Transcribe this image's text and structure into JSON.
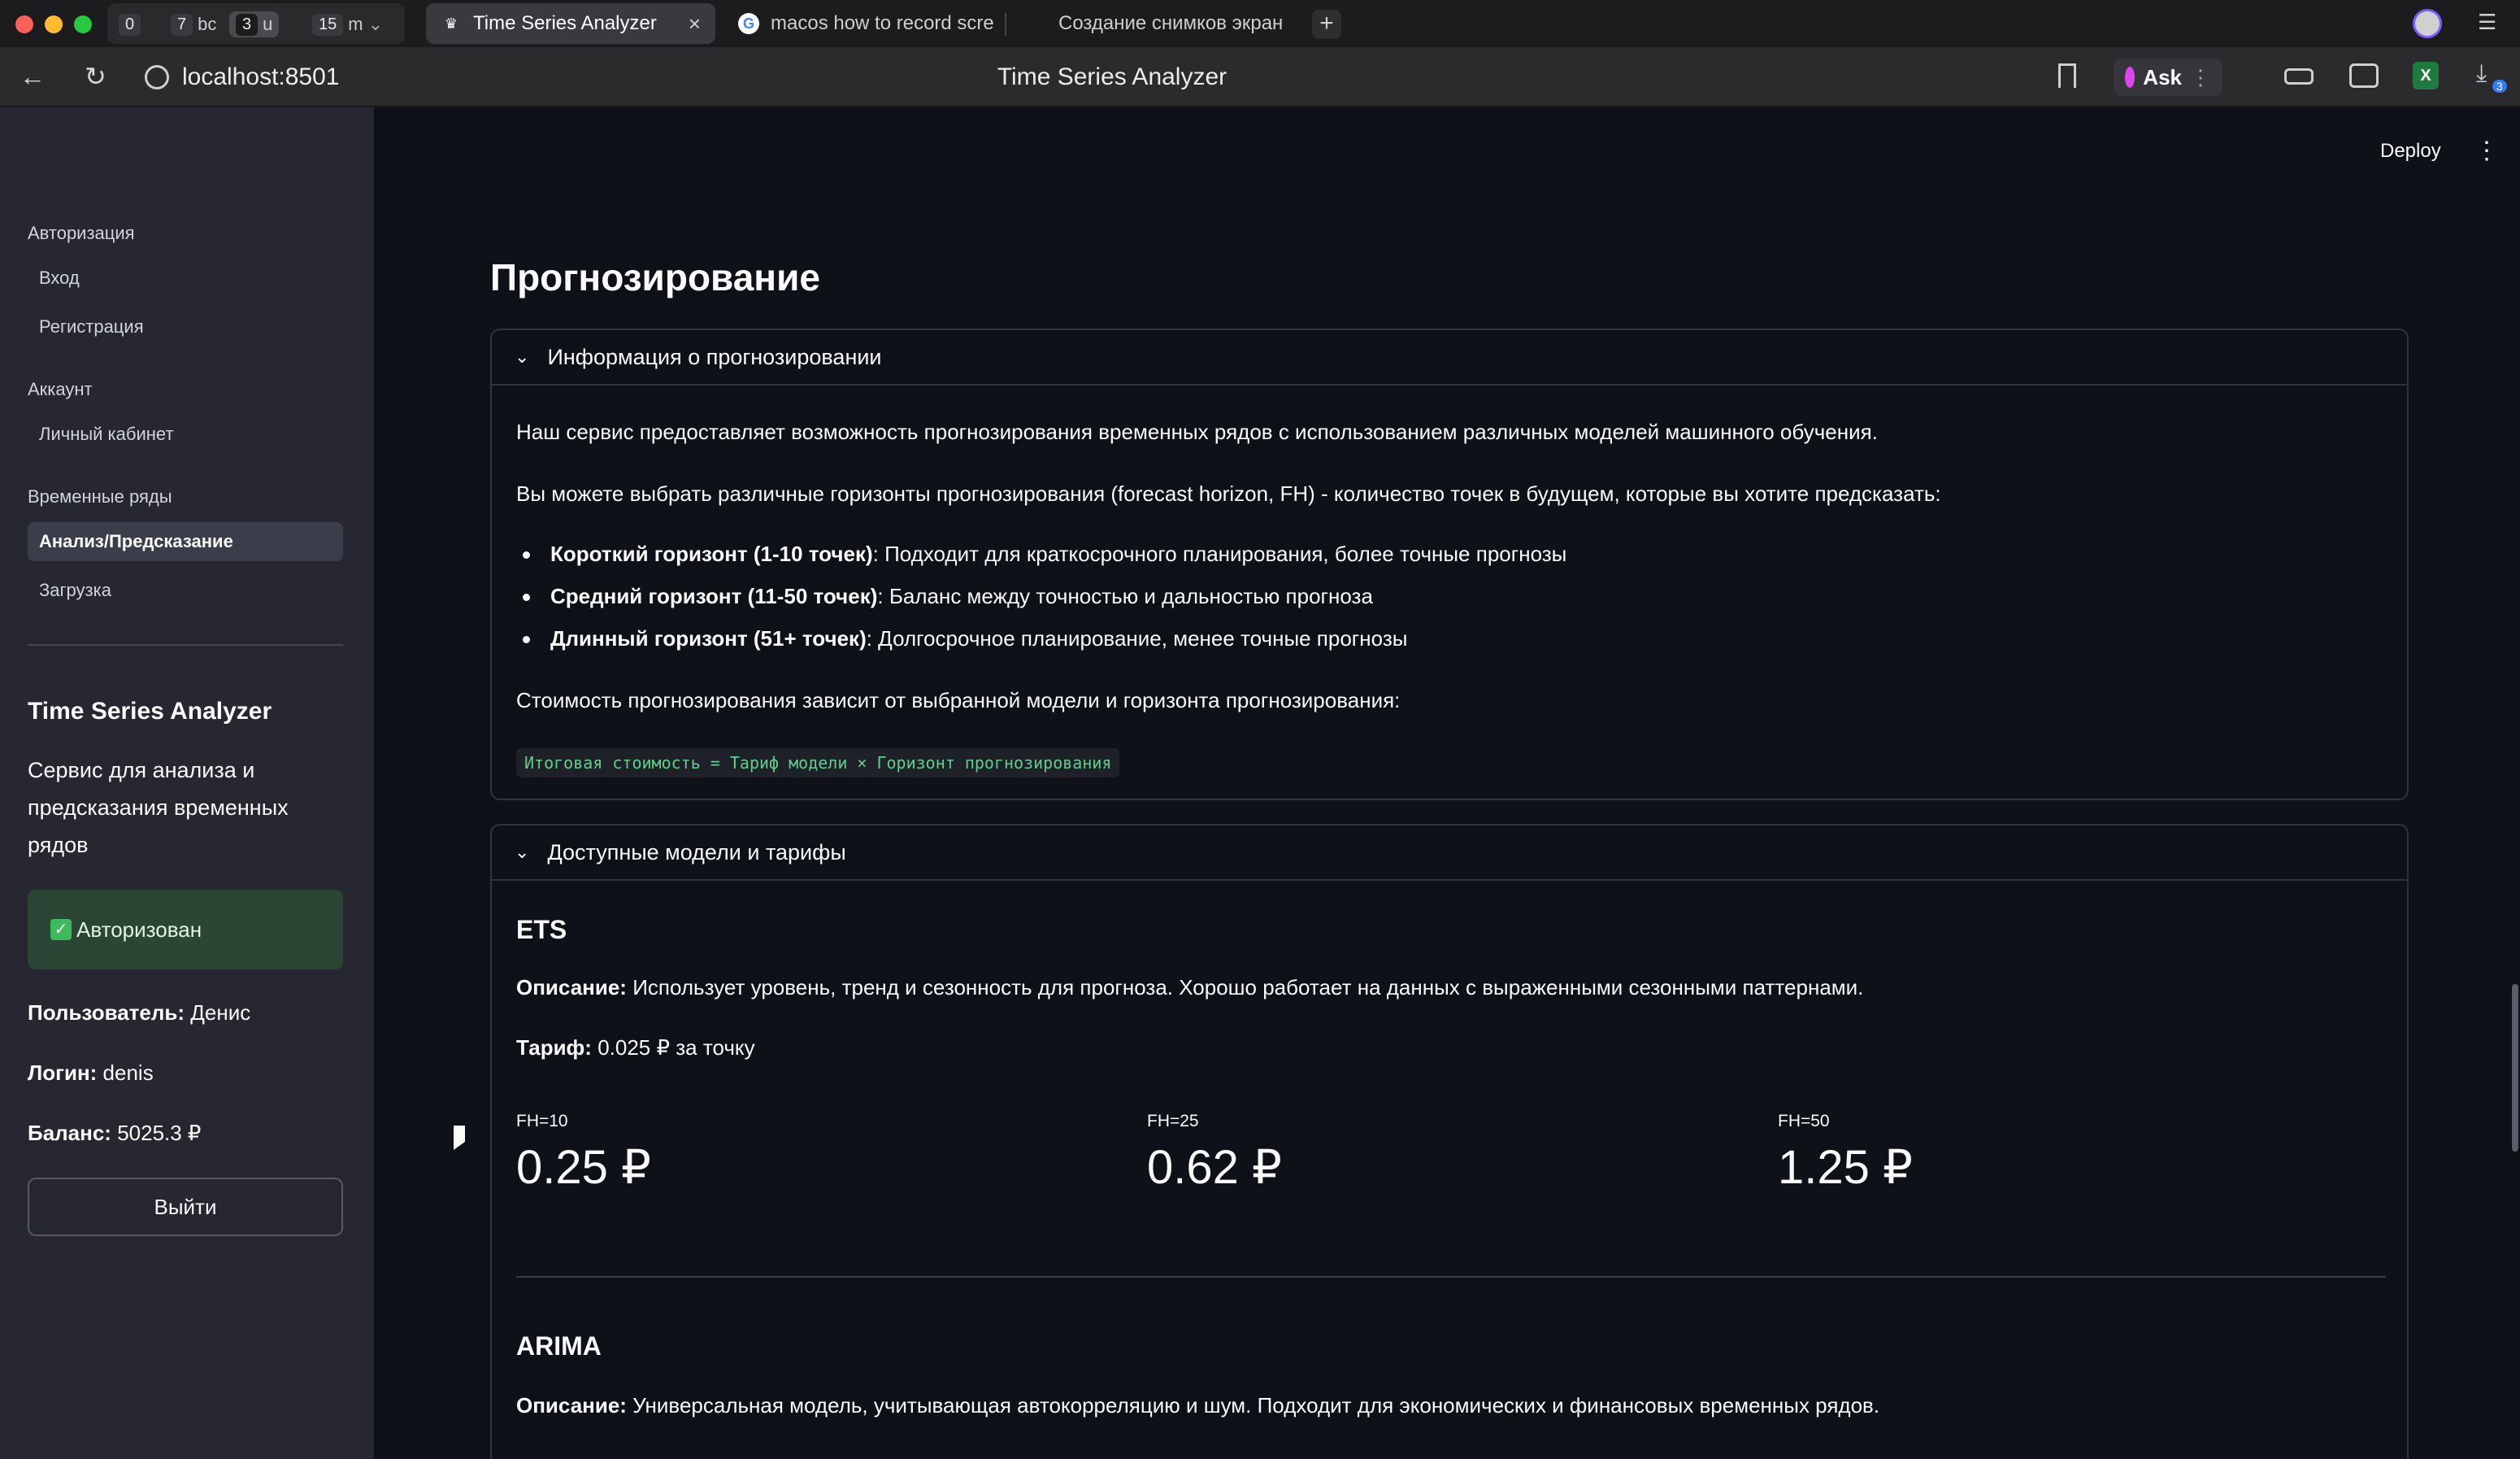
{
  "browser": {
    "tab_groups": [
      {
        "num": "0",
        "sub": ""
      },
      {
        "num": "7",
        "sub": "bc"
      },
      {
        "num": "3",
        "sub": "u"
      },
      {
        "num": "15",
        "sub": "m"
      }
    ],
    "tabs": [
      {
        "title": "Time Series Analyzer"
      },
      {
        "title": "macos how to record scre"
      },
      {
        "title": "Создание снимков экран"
      }
    ],
    "url": "localhost:8501",
    "page_title": "Time Series Analyzer",
    "ask_label": "Ask",
    "downloads_count": "3"
  },
  "sidebar": {
    "sections": {
      "auth": "Авторизация",
      "account": "Аккаунт",
      "timeseries": "Временные ряды"
    },
    "items": {
      "login": "Вход",
      "register": "Регистрация",
      "cabinet": "Личный кабинет",
      "analysis": "Анализ/Предсказание",
      "upload": "Загрузка"
    },
    "app_title": "Time Series Analyzer",
    "app_description": "Сервис для анализа и предсказания временных рядов",
    "auth_status": "Авторизован",
    "user_label": "Пользователь:",
    "user_value": "Денис",
    "login_label": "Логин:",
    "login_value": "denis",
    "balance_label": "Баланс:",
    "balance_value": "5025.3 ₽",
    "logout_label": "Выйти"
  },
  "header": {
    "deploy_label": "Deploy"
  },
  "main": {
    "title": "Прогнозирование",
    "info_expander": {
      "title": "Информация о прогнозировании",
      "p1": "Наш сервис предоставляет возможность прогнозирования временных рядов с использованием различных моделей машинного обучения.",
      "p2": "Вы можете выбрать различные горизонты прогнозирования (forecast horizon, FH) - количество точек в будущем, которые вы хотите предсказать:",
      "bullets": [
        {
          "bold": "Короткий горизонт (1-10 точек)",
          "text": ": Подходит для краткосрочного планирования, более точные прогнозы"
        },
        {
          "bold": "Средний горизонт (11-50 точек)",
          "text": ": Баланс между точностью и дальностью прогноза"
        },
        {
          "bold": "Длинный горизонт (51+ точек)",
          "text": ": Долгосрочное планирование, менее точные прогнозы"
        }
      ],
      "p3": "Стоимость прогнозирования зависит от выбранной модели и горизонта прогнозирования:",
      "formula": "Итоговая стоимость = Тариф модели × Горизонт прогнозирования"
    },
    "models_expander": {
      "title": "Доступные модели и тарифы",
      "description_label": "Описание:",
      "tariff_label": "Тариф:",
      "models": [
        {
          "name": "ETS",
          "description": "Использует уровень, тренд и сезонность для прогноза. Хорошо работает на данных с выраженными сезонными паттернами.",
          "tariff": "0.025 ₽ за точку",
          "metrics": [
            {
              "label": "FH=10",
              "value": "0.25 ₽"
            },
            {
              "label": "FH=25",
              "value": "0.62 ₽"
            },
            {
              "label": "FH=50",
              "value": "1.25 ₽"
            }
          ]
        },
        {
          "name": "ARIMA",
          "description": "Универсальная модель, учитывающая автокорреляцию и шум. Подходит для экономических и финансовых временных рядов."
        }
      ]
    }
  }
}
